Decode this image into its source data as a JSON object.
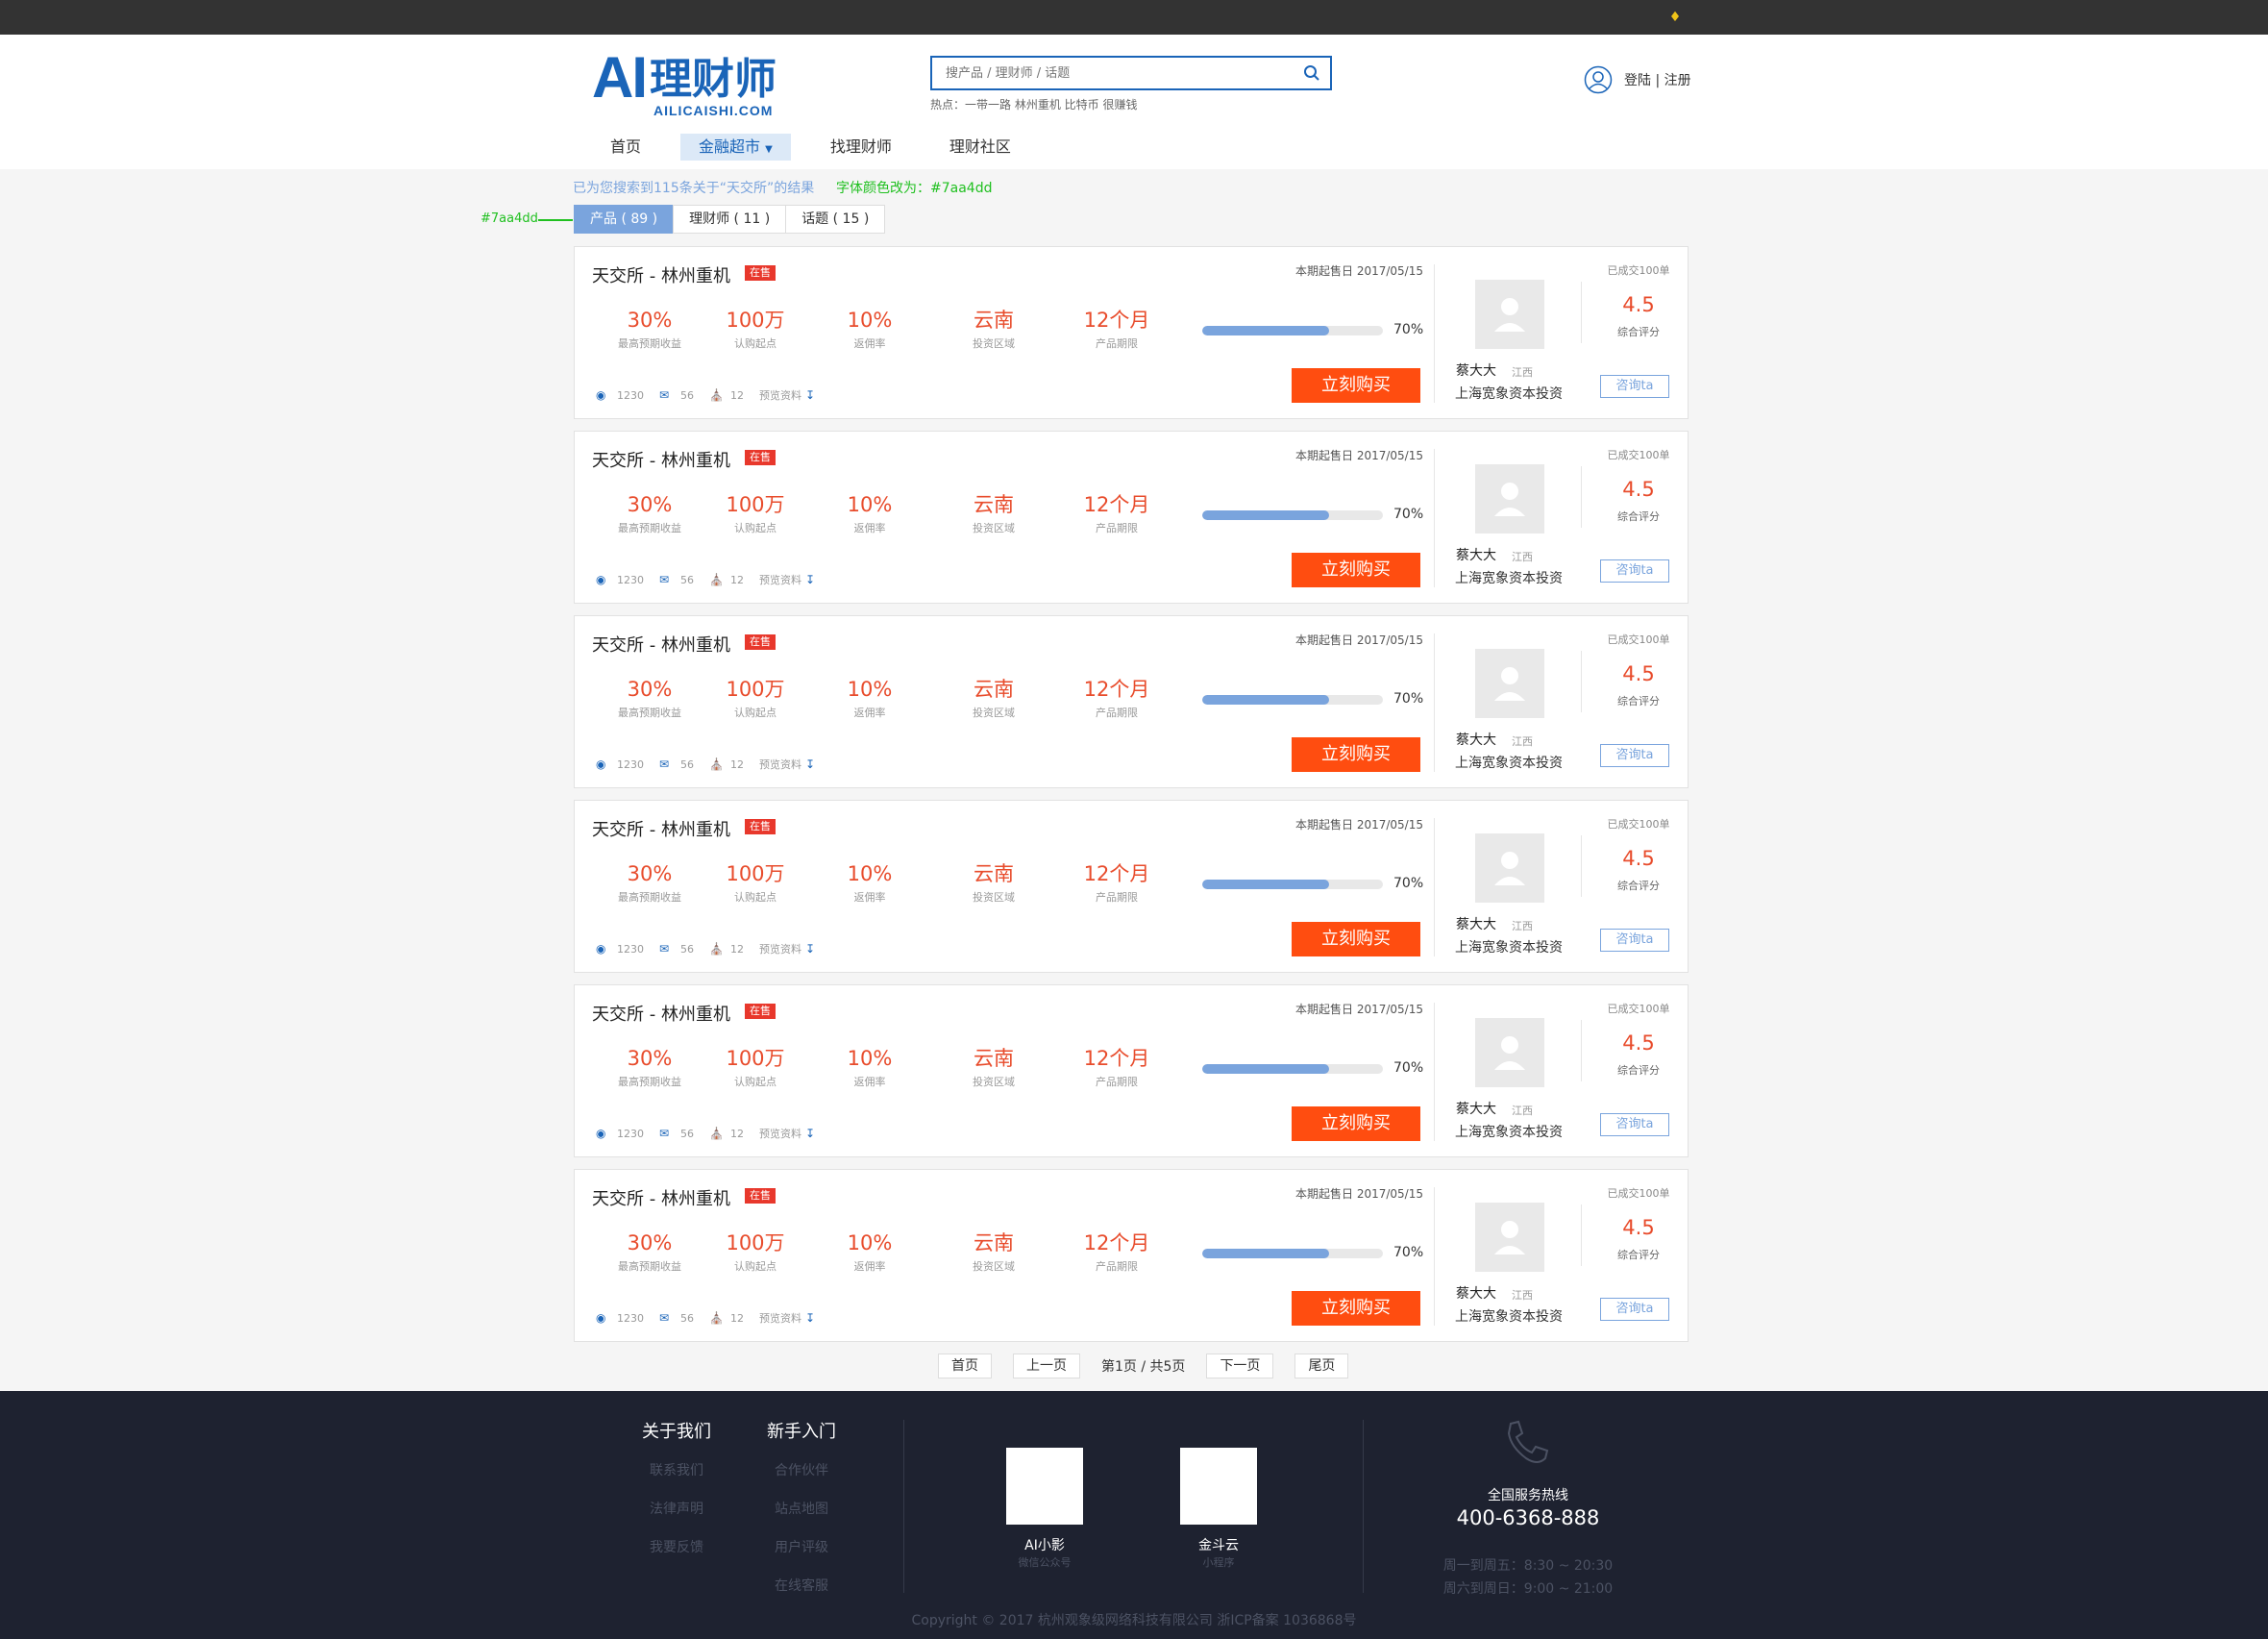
{
  "topbar": {
    "bell_icon": "bell-icon"
  },
  "logo": {
    "main": "AI",
    "cn": "理财师",
    "sub": "AILICAISHI.COM"
  },
  "search": {
    "placeholder": "搜产品 / 理财师 / 话题",
    "hot": "热点：一带一路 林州重机 比特币 很赚钱"
  },
  "login": {
    "text": "登陆 | 注册"
  },
  "nav": [
    "首页",
    "金融超市",
    "找理财师",
    "理财社区"
  ],
  "result_tip": "已为您搜索到115条关于“天交所”的结果",
  "note_color": "字体颜色改为：#7aa4dd",
  "note_color2": "#7aa4dd",
  "tabs": [
    "产品 ( 89 )",
    "理财师 ( 11 )",
    "话题 ( 15 )"
  ],
  "colors": {
    "accent": "#7aa4dd",
    "brand": "#1a64b8",
    "buy": "#ff4d10",
    "metric": "#e84c2c"
  },
  "products": [
    {
      "title": "天交所 - 林州重机",
      "badge": "在售",
      "date": "本期起售日 2017/05/15",
      "m1": "30%",
      "m1l": "最高预期收益",
      "m2": "100万",
      "m2l": "认购起点",
      "m3": "10%",
      "m3l": "返佣率",
      "m4": "云南",
      "m4l": "投资区域",
      "m5": "12个月",
      "m5l": "产品期限",
      "progress": 0.7,
      "pct": "70%",
      "views": "1230",
      "comments": "56",
      "cart": "12",
      "preview": "预览资料",
      "buy": "立刻购买",
      "advisor": "蔡大大",
      "loc": "江西",
      "company": "上海宽象资本投资",
      "deals": "已成交100单",
      "score": "4.5",
      "score_label": "综合评分",
      "consult": "咨询ta"
    },
    {
      "title": "天交所 - 林州重机",
      "badge": "在售",
      "date": "本期起售日 2017/05/15",
      "m1": "30%",
      "m1l": "最高预期收益",
      "m2": "100万",
      "m2l": "认购起点",
      "m3": "10%",
      "m3l": "返佣率",
      "m4": "云南",
      "m4l": "投资区域",
      "m5": "12个月",
      "m5l": "产品期限",
      "progress": 0.7,
      "pct": "70%",
      "views": "1230",
      "comments": "56",
      "cart": "12",
      "preview": "预览资料",
      "buy": "立刻购买",
      "advisor": "蔡大大",
      "loc": "江西",
      "company": "上海宽象资本投资",
      "deals": "已成交100单",
      "score": "4.5",
      "score_label": "综合评分",
      "consult": "咨询ta"
    },
    {
      "title": "天交所 - 林州重机",
      "badge": "在售",
      "date": "本期起售日 2017/05/15",
      "m1": "30%",
      "m1l": "最高预期收益",
      "m2": "100万",
      "m2l": "认购起点",
      "m3": "10%",
      "m3l": "返佣率",
      "m4": "云南",
      "m4l": "投资区域",
      "m5": "12个月",
      "m5l": "产品期限",
      "progress": 0.7,
      "pct": "70%",
      "views": "1230",
      "comments": "56",
      "cart": "12",
      "preview": "预览资料",
      "buy": "立刻购买",
      "advisor": "蔡大大",
      "loc": "江西",
      "company": "上海宽象资本投资",
      "deals": "已成交100单",
      "score": "4.5",
      "score_label": "综合评分",
      "consult": "咨询ta"
    },
    {
      "title": "天交所 - 林州重机",
      "badge": "在售",
      "date": "本期起售日 2017/05/15",
      "m1": "30%",
      "m1l": "最高预期收益",
      "m2": "100万",
      "m2l": "认购起点",
      "m3": "10%",
      "m3l": "返佣率",
      "m4": "云南",
      "m4l": "投资区域",
      "m5": "12个月",
      "m5l": "产品期限",
      "progress": 0.7,
      "pct": "70%",
      "views": "1230",
      "comments": "56",
      "cart": "12",
      "preview": "预览资料",
      "buy": "立刻购买",
      "advisor": "蔡大大",
      "loc": "江西",
      "company": "上海宽象资本投资",
      "deals": "已成交100单",
      "score": "4.5",
      "score_label": "综合评分",
      "consult": "咨询ta"
    },
    {
      "title": "天交所 - 林州重机",
      "badge": "在售",
      "date": "本期起售日 2017/05/15",
      "m1": "30%",
      "m1l": "最高预期收益",
      "m2": "100万",
      "m2l": "认购起点",
      "m3": "10%",
      "m3l": "返佣率",
      "m4": "云南",
      "m4l": "投资区域",
      "m5": "12个月",
      "m5l": "产品期限",
      "progress": 0.7,
      "pct": "70%",
      "views": "1230",
      "comments": "56",
      "cart": "12",
      "preview": "预览资料",
      "buy": "立刻购买",
      "advisor": "蔡大大",
      "loc": "江西",
      "company": "上海宽象资本投资",
      "deals": "已成交100单",
      "score": "4.5",
      "score_label": "综合评分",
      "consult": "咨询ta"
    },
    {
      "title": "天交所 - 林州重机",
      "badge": "在售",
      "date": "本期起售日 2017/05/15",
      "m1": "30%",
      "m1l": "最高预期收益",
      "m2": "100万",
      "m2l": "认购起点",
      "m3": "10%",
      "m3l": "返佣率",
      "m4": "云南",
      "m4l": "投资区域",
      "m5": "12个月",
      "m5l": "产品期限",
      "progress": 0.7,
      "pct": "70%",
      "views": "1230",
      "comments": "56",
      "cart": "12",
      "preview": "预览资料",
      "buy": "立刻购买",
      "advisor": "蔡大大",
      "loc": "江西",
      "company": "上海宽象资本投资",
      "deals": "已成交100单",
      "score": "4.5",
      "score_label": "综合评分",
      "consult": "咨询ta"
    }
  ],
  "pager": {
    "first": "首页",
    "prev": "上一页",
    "info": "第1页 / 共5页",
    "next": "下一页",
    "last": "尾页"
  },
  "footer": {
    "about": "关于我们",
    "about_links": [
      "联系我们",
      "法律声明",
      "我要反馈"
    ],
    "newbie": "新手入门",
    "newbie_links": [
      "合作伙伴",
      "站点地图",
      "用户评级",
      "在线客服"
    ],
    "qr1_name": "AI小影",
    "qr1_sub": "微信公众号",
    "qr2_name": "金斗云",
    "qr2_sub": "小程序",
    "hotline_label": "全国服务热线",
    "hotline": "400-6368-888",
    "hours1": "周一到周五：8:30 ~ 20:30",
    "hours2": "周六到周日：9:00 ~ 21:00",
    "copyright": "Copyright © 2017 杭州观象级网络科技有限公司 浙ICP备案 1036868号"
  }
}
